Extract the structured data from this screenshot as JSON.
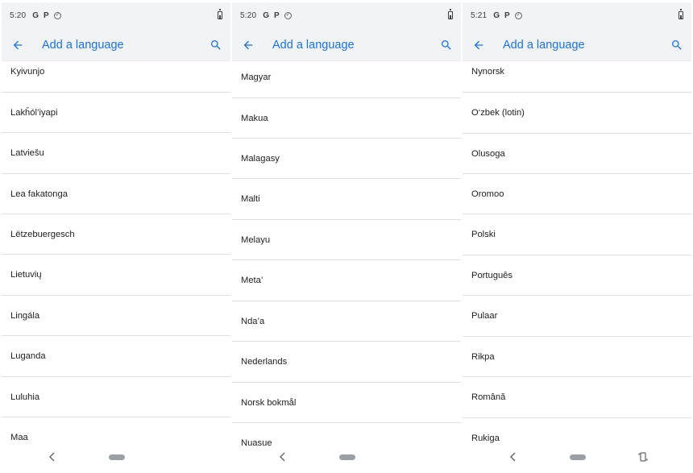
{
  "screens": [
    {
      "status": {
        "time": "5:20",
        "notif_icons": [
          "G",
          "P",
          "check-circle-icon"
        ],
        "battery_icon": "battery-icon"
      },
      "app_bar": {
        "title": "Add a language",
        "back_icon": "arrow-back-icon",
        "search_icon": "search-icon"
      },
      "languages": [
        "Kyivunjo",
        "Lakȟól’iyapi",
        "Latviešu",
        "Lea fakatonga",
        "Lëtzebuergesch",
        "Lietuvių",
        "Lingála",
        "Luganda",
        "Luluhia",
        "Maa"
      ],
      "nav": {
        "back_icon": "nav-back-icon",
        "home_icon": "home-pill-icon",
        "rotate_icon": null
      }
    },
    {
      "status": {
        "time": "5:20",
        "notif_icons": [
          "G",
          "P",
          "check-circle-icon"
        ],
        "battery_icon": "battery-icon"
      },
      "app_bar": {
        "title": "Add a language",
        "back_icon": "arrow-back-icon",
        "search_icon": "search-icon"
      },
      "languages": [
        "Magyar",
        "Makua",
        "Malagasy",
        "Malti",
        "Melayu",
        "Meta’",
        "Nda’a",
        "Nederlands",
        "Norsk bokmål",
        "Nuasue"
      ],
      "nav": {
        "back_icon": "nav-back-icon",
        "home_icon": "home-pill-icon",
        "rotate_icon": null
      }
    },
    {
      "status": {
        "time": "5:21",
        "notif_icons": [
          "G",
          "P",
          "check-circle-icon"
        ],
        "battery_icon": "battery-icon"
      },
      "app_bar": {
        "title": "Add a language",
        "back_icon": "arrow-back-icon",
        "search_icon": "search-icon"
      },
      "languages": [
        "Nynorsk",
        "O‘zbek (lotin)",
        "Olusoga",
        "Oromoo",
        "Polski",
        "Português",
        "Pulaar",
        "Rikpa",
        "Română",
        "Rukiga"
      ],
      "nav": {
        "back_icon": "nav-back-icon",
        "home_icon": "home-pill-icon",
        "rotate_icon": "rotate-screen-icon"
      }
    }
  ],
  "colors": {
    "accent": "#1a73e8",
    "bar_bg": "#f1f3f4",
    "divider": "#e0e0e0",
    "text": "#202124"
  }
}
